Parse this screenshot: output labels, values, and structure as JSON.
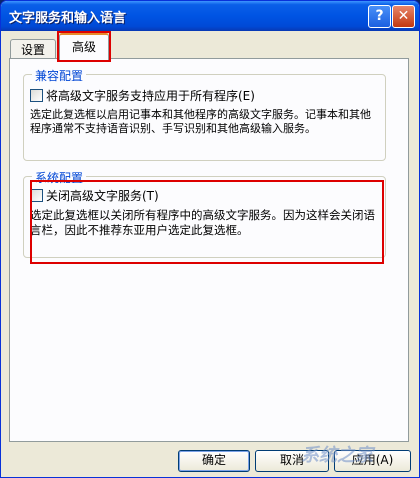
{
  "window": {
    "title": "文字服务和输入语言",
    "help_label": "?",
    "close_label": "✕"
  },
  "tabs": [
    {
      "label": "设置",
      "selected": false
    },
    {
      "label": "高级",
      "selected": true
    }
  ],
  "compat": {
    "group_label": "兼容配置",
    "checkbox_label": "将高级文字服务支持应用于所有程序(E)",
    "checked": false,
    "description": "选定此复选框以启用记事本和其他程序的高级文字服务。记事本和其他程序通常不支持语音识别、手写识别和其他高级输入服务。"
  },
  "system": {
    "group_label": "系统配置",
    "checkbox_label": "关闭高级文字服务(T)",
    "checked": false,
    "description": "选定此复选框以关闭所有程序中的高级文字服务。因为这样会关闭语言栏，因此不推荐东亚用户选定此复选框。"
  },
  "buttons": {
    "ok": "确定",
    "cancel": "取消",
    "apply": "应用(A)"
  },
  "watermark": "系统之家",
  "colors": {
    "titlebar": "#0054e3",
    "dialog_bg": "#ece9d8",
    "group_label": "#0046d5",
    "highlight": "#dd0000"
  }
}
